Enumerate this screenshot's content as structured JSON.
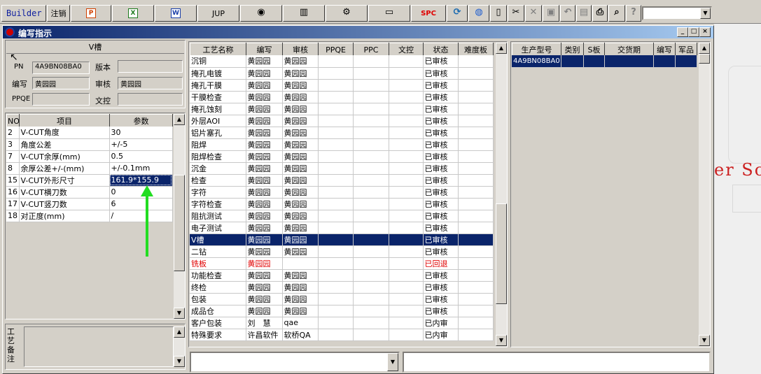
{
  "toolbar": {
    "builder_label": "Builder",
    "logout_label": "注销",
    "jup_label": "JUP",
    "spc_label": "SPC",
    "icons": [
      "ppt-icon",
      "excel-icon",
      "word-icon",
      "eye-icon",
      "database-icon",
      "tools-icon",
      "computer-icon",
      "refresh-icon",
      "globe-icon",
      "new-document-icon",
      "cut-icon",
      "delete-icon",
      "save-icon",
      "undo-icon",
      "preview-icon",
      "print-icon",
      "find-icon",
      "help-icon"
    ],
    "combo_value": ""
  },
  "window": {
    "title": "编写指示"
  },
  "left": {
    "section_title": "V槽",
    "pn_label": "PN",
    "pn_value": "4A9BN08BA0",
    "version_label": "版本",
    "version_value": "",
    "author_label": "编写",
    "author_value": "黄园园",
    "reviewer_label": "审核",
    "reviewer_value": "黄园园",
    "ppqe_label": "PPQE",
    "ppqe_value": "",
    "doc_control_label": "文控",
    "doc_control_value": "",
    "param_headers": [
      "NO",
      "项目",
      "参数"
    ],
    "params": [
      {
        "no": "2",
        "item": "V-CUT角度",
        "value": "30"
      },
      {
        "no": "3",
        "item": "角度公差",
        "value": "+/-5"
      },
      {
        "no": "7",
        "item": "V-CUT余厚(mm)",
        "value": "0.5"
      },
      {
        "no": "8",
        "item": "余厚公差+/-(mm)",
        "value": "+/-0.1mm"
      },
      {
        "no": "15",
        "item": "V-CUT外形尺寸",
        "value": "161.9*155.9"
      },
      {
        "no": "16",
        "item": "V-CUT横刀数",
        "value": "0"
      },
      {
        "no": "17",
        "item": "V-CUT竖刀数",
        "value": "6"
      },
      {
        "no": "18",
        "item": "对正度(mm)",
        "value": "/"
      }
    ],
    "notes_label": "工艺备注",
    "notes_value": ""
  },
  "process": {
    "headers": [
      "工艺名称",
      "编写",
      "审核",
      "PPQE",
      "PPC",
      "文控",
      "状态",
      "难度板"
    ],
    "rows": [
      {
        "name": "沉铜",
        "author": "黄园园",
        "reviewer": "黄园园",
        "ppqe": "",
        "ppc": "",
        "doc": "",
        "status": "已审核",
        "difficulty": ""
      },
      {
        "name": "掩孔电镀",
        "author": "黄园园",
        "reviewer": "黄园园",
        "ppqe": "",
        "ppc": "",
        "doc": "",
        "status": "已审核",
        "difficulty": ""
      },
      {
        "name": "掩孔干膜",
        "author": "黄园园",
        "reviewer": "黄园园",
        "ppqe": "",
        "ppc": "",
        "doc": "",
        "status": "已审核",
        "difficulty": ""
      },
      {
        "name": "干膜检查",
        "author": "黄园园",
        "reviewer": "黄园园",
        "ppqe": "",
        "ppc": "",
        "doc": "",
        "status": "已审核",
        "difficulty": ""
      },
      {
        "name": "掩孔蚀刻",
        "author": "黄园园",
        "reviewer": "黄园园",
        "ppqe": "",
        "ppc": "",
        "doc": "",
        "status": "已审核",
        "difficulty": ""
      },
      {
        "name": "外层AOI",
        "author": "黄园园",
        "reviewer": "黄园园",
        "ppqe": "",
        "ppc": "",
        "doc": "",
        "status": "已审核",
        "difficulty": ""
      },
      {
        "name": "铝片塞孔",
        "author": "黄园园",
        "reviewer": "黄园园",
        "ppqe": "",
        "ppc": "",
        "doc": "",
        "status": "已审核",
        "difficulty": ""
      },
      {
        "name": "阻焊",
        "author": "黄园园",
        "reviewer": "黄园园",
        "ppqe": "",
        "ppc": "",
        "doc": "",
        "status": "已审核",
        "difficulty": ""
      },
      {
        "name": "阻焊检查",
        "author": "黄园园",
        "reviewer": "黄园园",
        "ppqe": "",
        "ppc": "",
        "doc": "",
        "status": "已审核",
        "difficulty": ""
      },
      {
        "name": "沉金",
        "author": "黄园园",
        "reviewer": "黄园园",
        "ppqe": "",
        "ppc": "",
        "doc": "",
        "status": "已审核",
        "difficulty": ""
      },
      {
        "name": "检查",
        "author": "黄园园",
        "reviewer": "黄园园",
        "ppqe": "",
        "ppc": "",
        "doc": "",
        "status": "已审核",
        "difficulty": ""
      },
      {
        "name": "字符",
        "author": "黄园园",
        "reviewer": "黄园园",
        "ppqe": "",
        "ppc": "",
        "doc": "",
        "status": "已审核",
        "difficulty": ""
      },
      {
        "name": "字符检查",
        "author": "黄园园",
        "reviewer": "黄园园",
        "ppqe": "",
        "ppc": "",
        "doc": "",
        "status": "已审核",
        "difficulty": ""
      },
      {
        "name": "阻抗测试",
        "author": "黄园园",
        "reviewer": "黄园园",
        "ppqe": "",
        "ppc": "",
        "doc": "",
        "status": "已审核",
        "difficulty": ""
      },
      {
        "name": "电子测试",
        "author": "黄园园",
        "reviewer": "黄园园",
        "ppqe": "",
        "ppc": "",
        "doc": "",
        "status": "已审核",
        "difficulty": ""
      },
      {
        "name": "V槽",
        "author": "黄园园",
        "reviewer": "黄园园",
        "ppqe": "",
        "ppc": "",
        "doc": "",
        "status": "已审核",
        "difficulty": ""
      },
      {
        "name": "二钻",
        "author": "黄园园",
        "reviewer": "黄园园",
        "ppqe": "",
        "ppc": "",
        "doc": "",
        "status": "已审核",
        "difficulty": ""
      },
      {
        "name": "铣板",
        "author": "黄园园",
        "reviewer": "",
        "ppqe": "",
        "ppc": "",
        "doc": "",
        "status": "已回退",
        "difficulty": ""
      },
      {
        "name": "功能检查",
        "author": "黄园园",
        "reviewer": "黄园园",
        "ppqe": "",
        "ppc": "",
        "doc": "",
        "status": "已审核",
        "difficulty": ""
      },
      {
        "name": "终检",
        "author": "黄园园",
        "reviewer": "黄园园",
        "ppqe": "",
        "ppc": "",
        "doc": "",
        "status": "已审核",
        "difficulty": ""
      },
      {
        "name": "包装",
        "author": "黄园园",
        "reviewer": "黄园园",
        "ppqe": "",
        "ppc": "",
        "doc": "",
        "status": "已审核",
        "difficulty": ""
      },
      {
        "name": "成品仓",
        "author": "黄园园",
        "reviewer": "黄园园",
        "ppqe": "",
        "ppc": "",
        "doc": "",
        "status": "已审核",
        "difficulty": ""
      },
      {
        "name": "客户包装",
        "author": "刘　慧",
        "reviewer": "qae",
        "ppqe": "",
        "ppc": "",
        "doc": "",
        "status": "已内审",
        "difficulty": ""
      },
      {
        "name": "特殊要求",
        "author": "许昌软件",
        "reviewer": "软桥QA",
        "ppqe": "",
        "ppc": "",
        "doc": "",
        "status": "已内审",
        "difficulty": ""
      }
    ]
  },
  "production": {
    "headers": [
      "生产型号",
      "类别",
      "S板",
      "交货期",
      "编写",
      "军品"
    ],
    "rows": [
      {
        "model": "4A9BN08BA0",
        "category": "",
        "s_board": "",
        "delivery": "",
        "author": "",
        "military": ""
      }
    ]
  },
  "bottom": {
    "combo_value": "",
    "text_value": ""
  },
  "background": {
    "text": "er Sc"
  },
  "colors": {
    "title_bar": "#0a246a",
    "selection": "#0a246a",
    "red_text": "#e00000",
    "annotation_arrow": "#22dd22"
  }
}
